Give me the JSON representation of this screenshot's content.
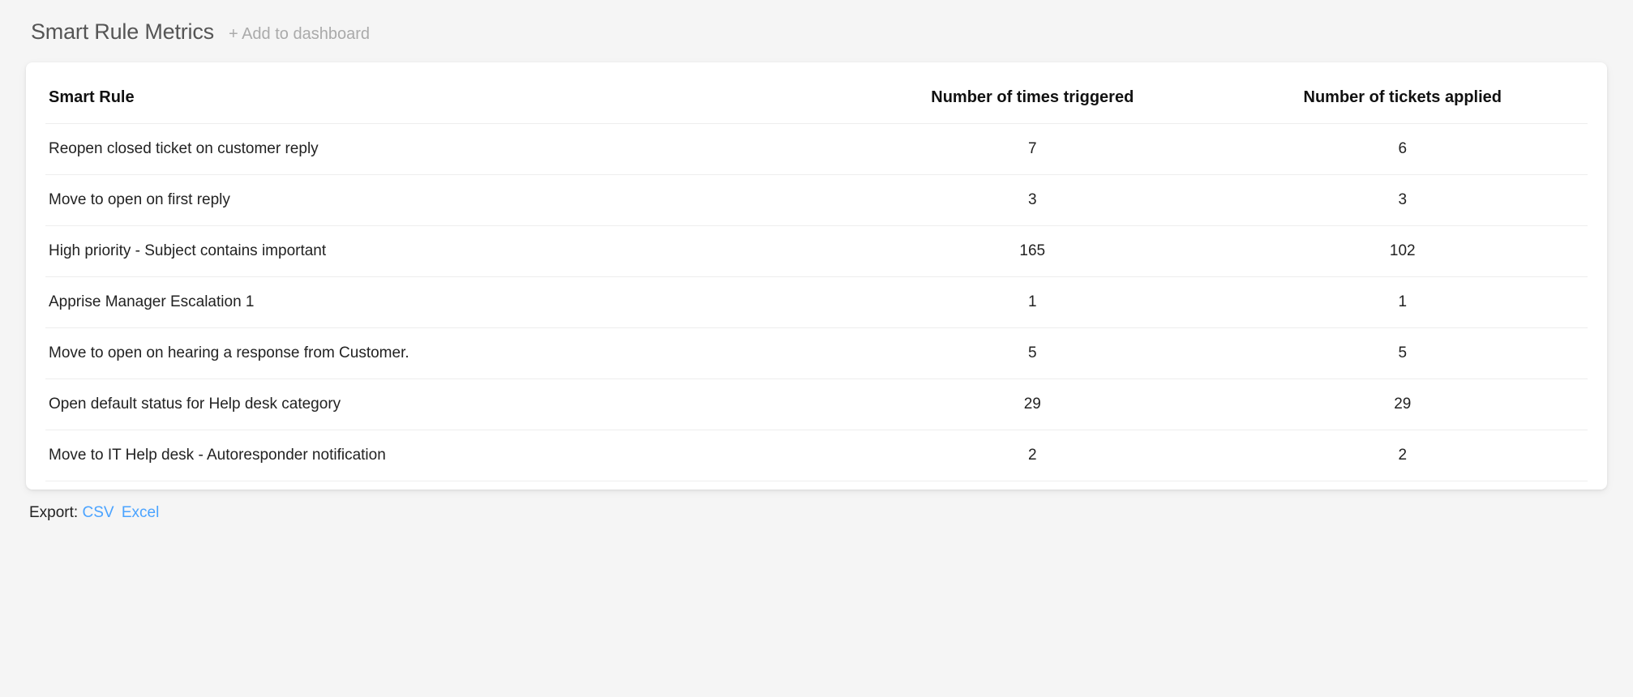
{
  "header": {
    "title": "Smart Rule Metrics",
    "add_dashboard": "+ Add to dashboard"
  },
  "table": {
    "columns": {
      "rule": "Smart Rule",
      "triggered": "Number of times triggered",
      "applied": "Number of tickets applied"
    },
    "rows": [
      {
        "rule": "Reopen closed ticket on customer reply",
        "triggered": "7",
        "applied": "6"
      },
      {
        "rule": "Move to open on first reply",
        "triggered": "3",
        "applied": "3"
      },
      {
        "rule": "High priority - Subject contains important",
        "triggered": "165",
        "applied": "102"
      },
      {
        "rule": "Apprise Manager Escalation 1",
        "triggered": "1",
        "applied": "1"
      },
      {
        "rule": "Move to open on hearing a response from Customer.",
        "triggered": "5",
        "applied": "5"
      },
      {
        "rule": "Open default status for Help desk category",
        "triggered": "29",
        "applied": "29"
      },
      {
        "rule": "Move to IT Help desk - Autoresponder notification",
        "triggered": "2",
        "applied": "2"
      }
    ]
  },
  "export": {
    "label": "Export:",
    "csv": "CSV",
    "excel": "Excel"
  }
}
